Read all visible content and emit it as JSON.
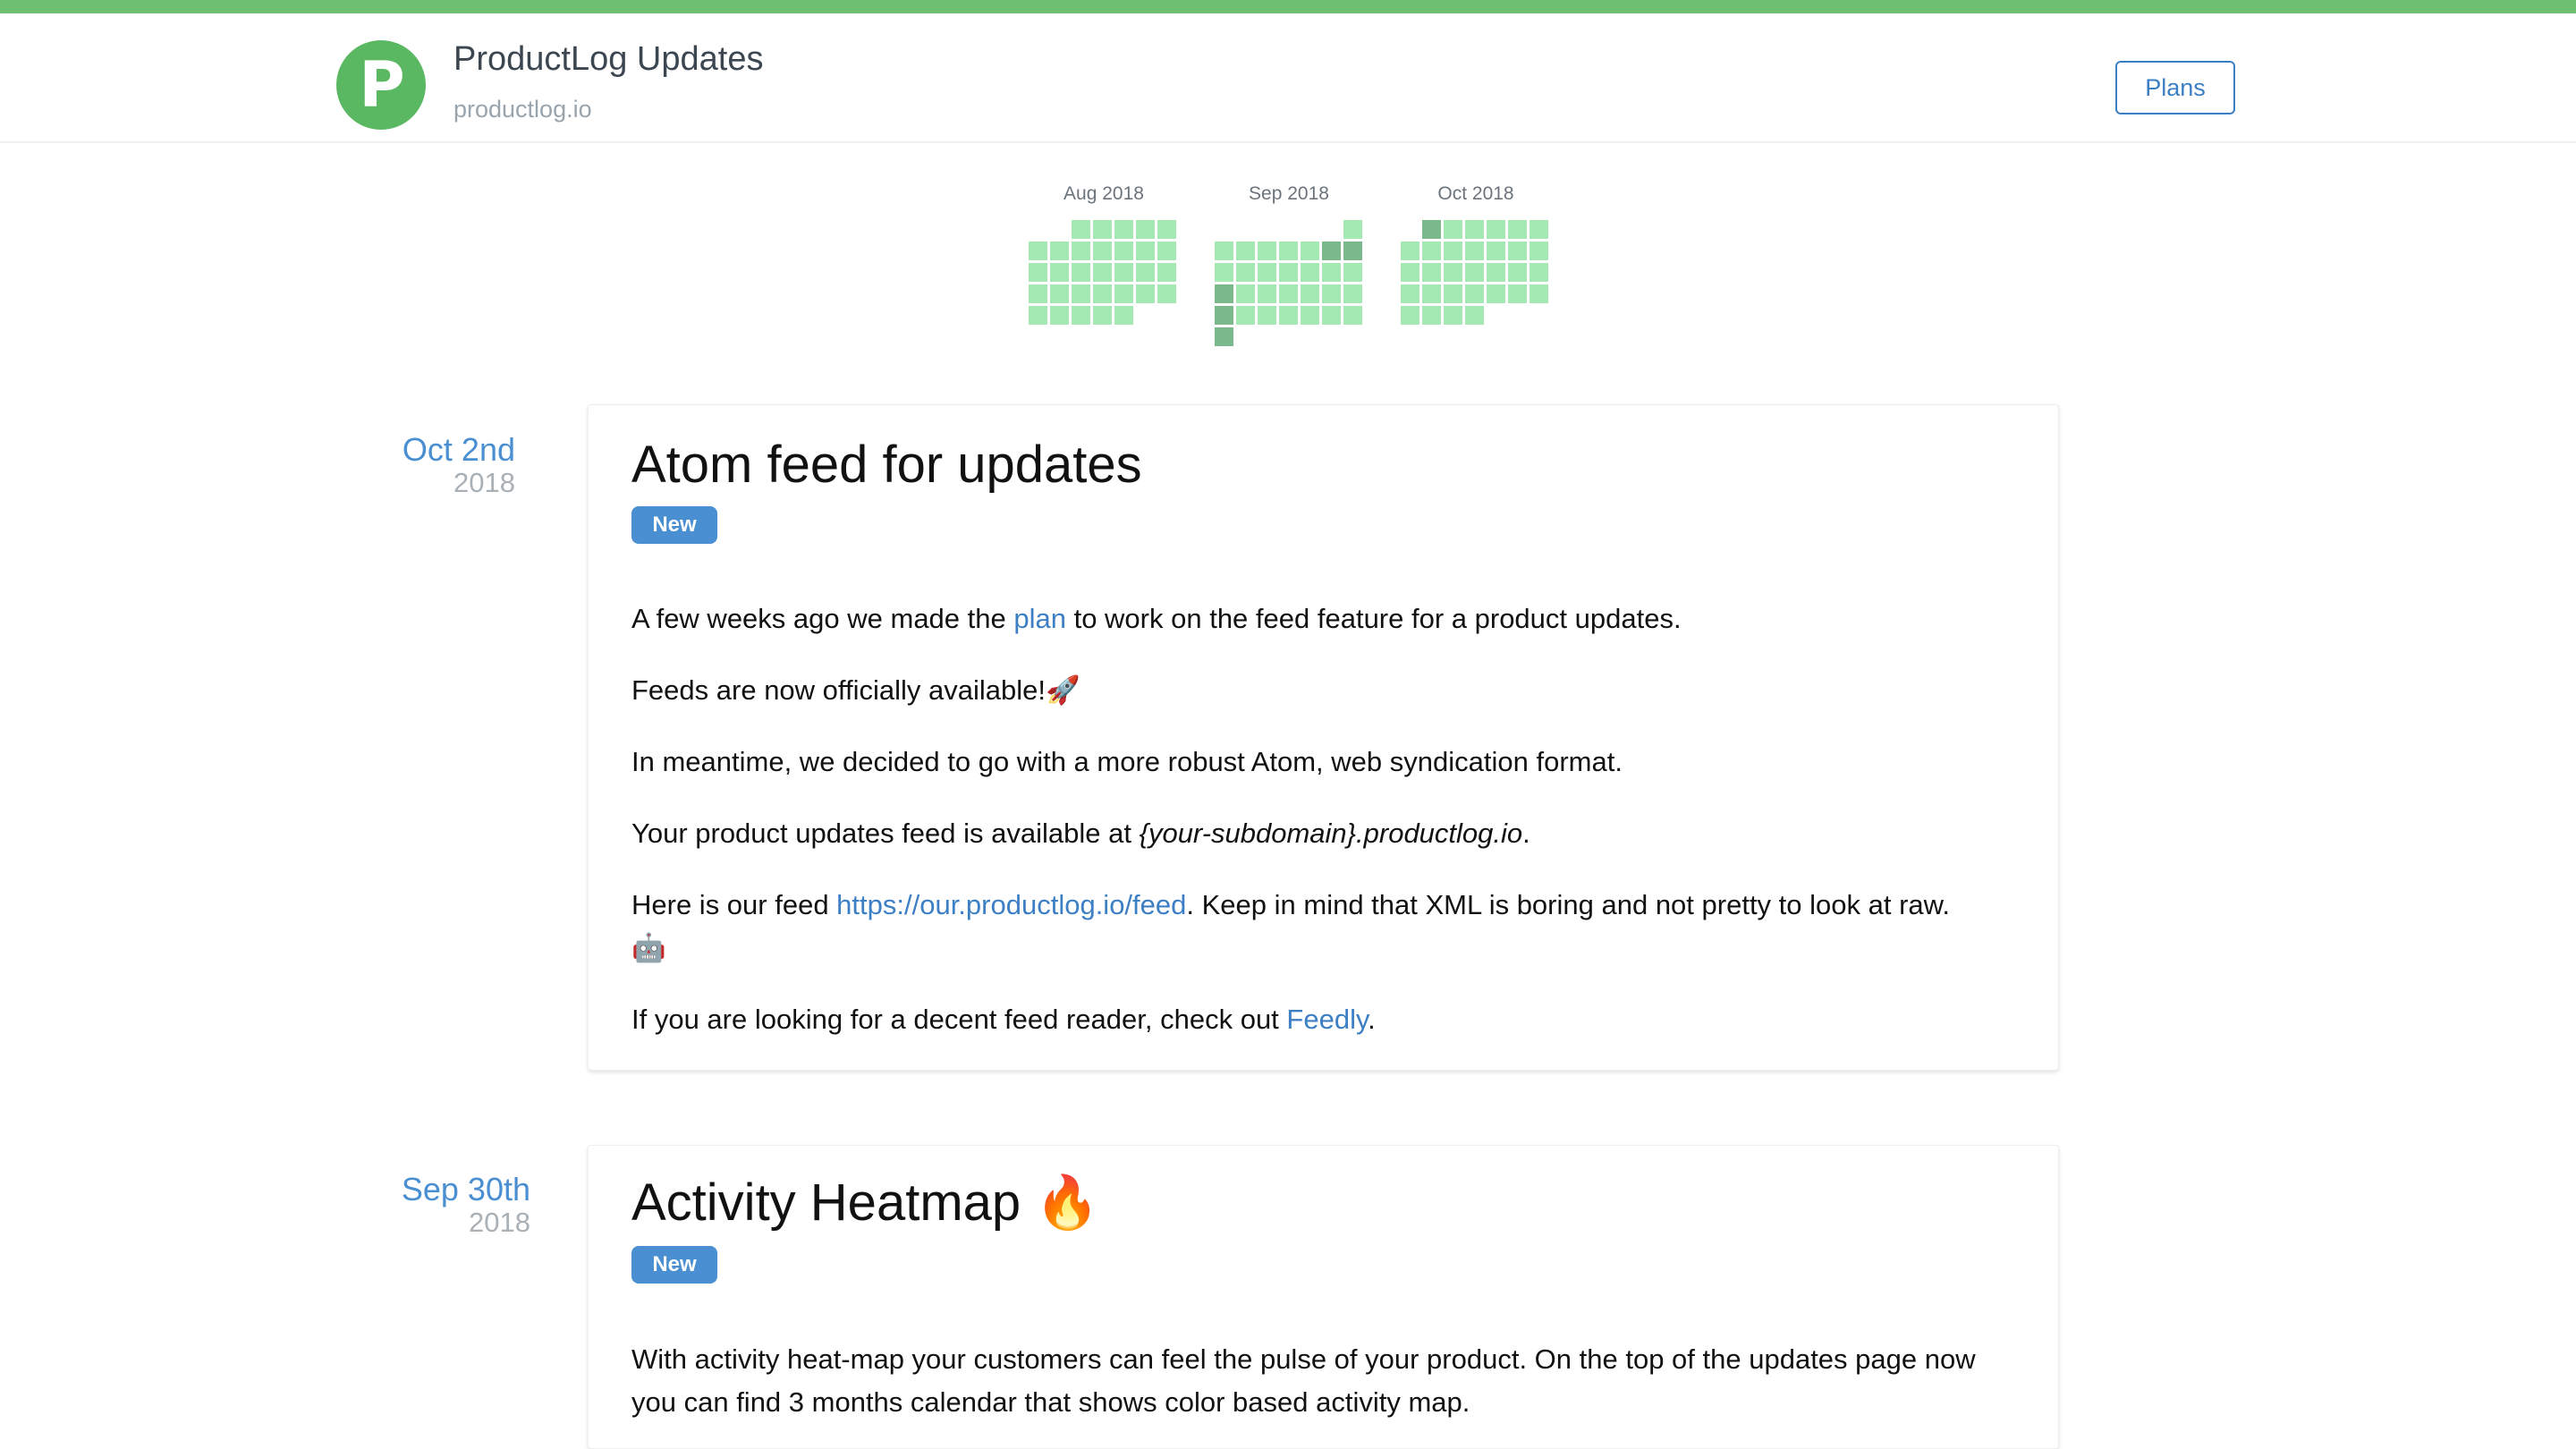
{
  "header": {
    "logo_letter": "P",
    "title": "ProductLog Updates",
    "domain": "productlog.io",
    "plans_label": "Plans",
    "accent_color": "#6fbf73",
    "link_color": "#3d7fc4"
  },
  "heatmap": {
    "months": [
      "Aug 2018",
      "Sep 2018",
      "Oct 2018"
    ],
    "light_color": "#a4e8b4",
    "dark_color": "#7bb98c"
  },
  "posts": [
    {
      "date": "Oct 2nd",
      "year": "2018",
      "title": "Atom feed for updates",
      "badge": "New",
      "p1_before": "A few weeks ago we made the ",
      "p1_link": "plan",
      "p1_after": " to work on the feed feature for a product updates.",
      "p2": "Feeds are now officially available!",
      "p2_emoji": "🚀",
      "p3": "In meantime, we decided to go with a more robust Atom, web syndication format.",
      "p4_before": "Your product updates feed is available at ",
      "p4_italic": "{your-subdomain}.productlog.io",
      "p4_after": ".",
      "p5_before": "Here is our feed ",
      "p5_link": "https://our.productlog.io/feed",
      "p5_after": ". Keep in mind that XML is boring and not pretty to look at raw.",
      "p5_emoji": "🤖",
      "p6_before": "If you are looking for a decent feed reader, check out ",
      "p6_link": "Feedly",
      "p6_after": "."
    },
    {
      "date": "Sep 30th",
      "year": "2018",
      "title": "Activity Heatmap",
      "title_emoji": "🔥",
      "badge": "New",
      "p1": "With activity heat-map your customers can feel the pulse of your product. On the top of the updates page now you can find 3 months calendar that shows color based activity map."
    }
  ]
}
